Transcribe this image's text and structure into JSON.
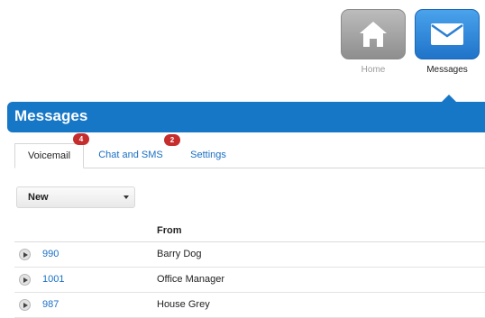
{
  "launcher": {
    "home_label": "Home",
    "messages_label": "Messages"
  },
  "header": {
    "title": "Messages"
  },
  "tabs": [
    {
      "label": "Voicemail",
      "badge": "4",
      "active": true
    },
    {
      "label": "Chat and SMS",
      "badge": "2",
      "active": false
    },
    {
      "label": "Settings",
      "active": false
    }
  ],
  "filter": {
    "selected": "New"
  },
  "table": {
    "column_from": "From",
    "rows": [
      {
        "number": "990",
        "from": "Barry Dog"
      },
      {
        "number": "1001",
        "from": "Office Manager"
      },
      {
        "number": "987",
        "from": "House Grey"
      }
    ]
  },
  "colors": {
    "brand_blue": "#1777c7",
    "link_blue": "#1a6fc4",
    "badge_red": "#c62d2d"
  },
  "icons": {
    "home": "home-icon",
    "messages": "envelope-icon",
    "play": "play-icon",
    "dropdown": "chevron-down-icon"
  }
}
